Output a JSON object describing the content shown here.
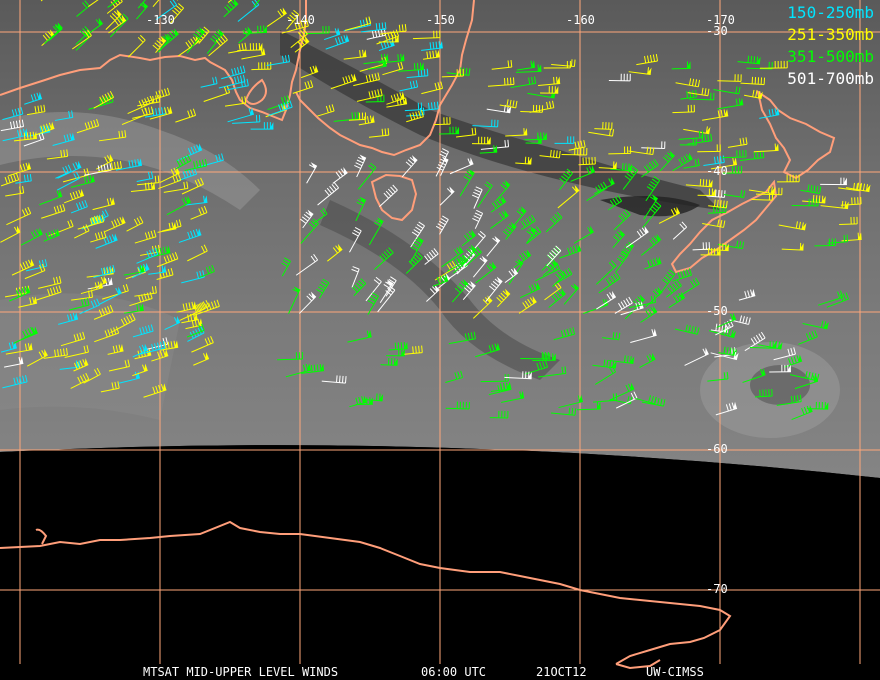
{
  "image": {
    "satellite": "MTSAT",
    "product": "MID-UPPER LEVEL WINDS",
    "time": "06:00 UTC",
    "date": "21OCT12",
    "source": "UW-CIMSS"
  },
  "legend": [
    {
      "label": "150-250mb",
      "color": "#00e5ff"
    },
    {
      "label": "251-350mb",
      "color": "#ffff00"
    },
    {
      "label": "351-500mb",
      "color": "#00ff00"
    },
    {
      "label": "501-700mb",
      "color": "#ffffff"
    }
  ],
  "longitude_labels": [
    "-130",
    "-140",
    "-150",
    "-160",
    "-170"
  ],
  "latitude_labels": [
    "-30",
    "-40",
    "-50",
    "-60",
    "-70"
  ],
  "colors": {
    "grid": "#ffa77a",
    "coast": "#ff9e7a",
    "space": "#000000",
    "cloud_base": "#6a6a6a"
  }
}
